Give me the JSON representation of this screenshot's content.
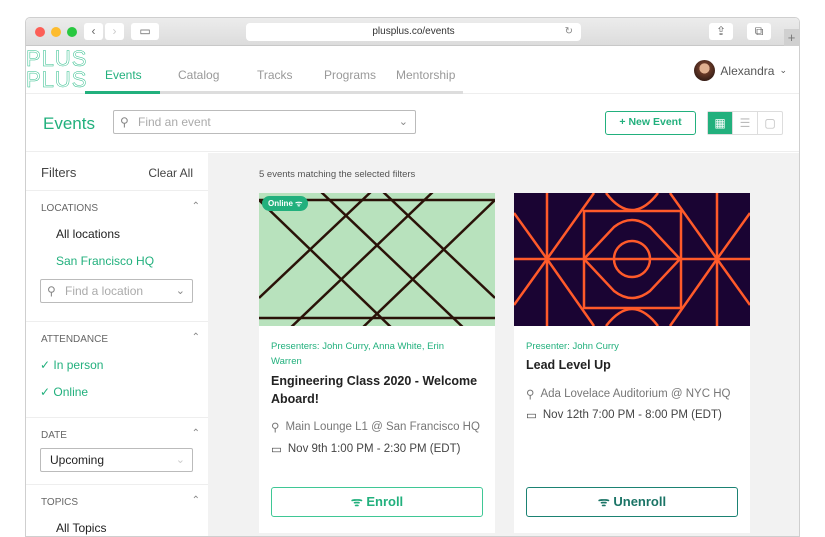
{
  "browser": {
    "url": "plusplus.co/events"
  },
  "logo": "PLUS PLUS",
  "nav": {
    "tabs": [
      "Events",
      "Catalog",
      "Tracks",
      "Programs",
      "Mentorship"
    ],
    "user": "Alexandra"
  },
  "header": {
    "title": "Events",
    "search_placeholder": "Find an event",
    "new_event": "+ New Event"
  },
  "filters": {
    "title": "Filters",
    "clear": "Clear All",
    "locations": {
      "label": "LOCATIONS",
      "items": [
        "All locations",
        "San Francisco HQ"
      ],
      "placeholder": "Find a location"
    },
    "attendance": {
      "label": "ATTENDANCE",
      "items": [
        "In person",
        "Online"
      ]
    },
    "date": {
      "label": "DATE",
      "value": "Upcoming"
    },
    "topics": {
      "label": "TOPICS",
      "items": [
        "All Topics"
      ]
    }
  },
  "results": {
    "count_text": "5 events matching the selected filters"
  },
  "events": [
    {
      "badge": "Online",
      "presenters": "Presenters: John Curry, Anna White, Erin Warren",
      "title": "Engineering Class 2020 - Welcome Aboard!",
      "location": "Main Lounge L1 @ San Francisco HQ",
      "time": "Nov 9th 1:00 PM - 2:30 PM (EDT)",
      "action": "Enroll"
    },
    {
      "presenters": "Presenter: John Curry",
      "title": "Lead Level Up",
      "location": "Ada Lovelace Auditorium @ NYC HQ",
      "time": "Nov 12th 7:00 PM - 8:00 PM (EDT)",
      "action": "Unenroll"
    }
  ],
  "colors": {
    "accent": "#22b07d",
    "card1_bg": "#b8e2bd",
    "card2_bg": "#1a0433",
    "card2_lines": "#ff5a2a"
  }
}
